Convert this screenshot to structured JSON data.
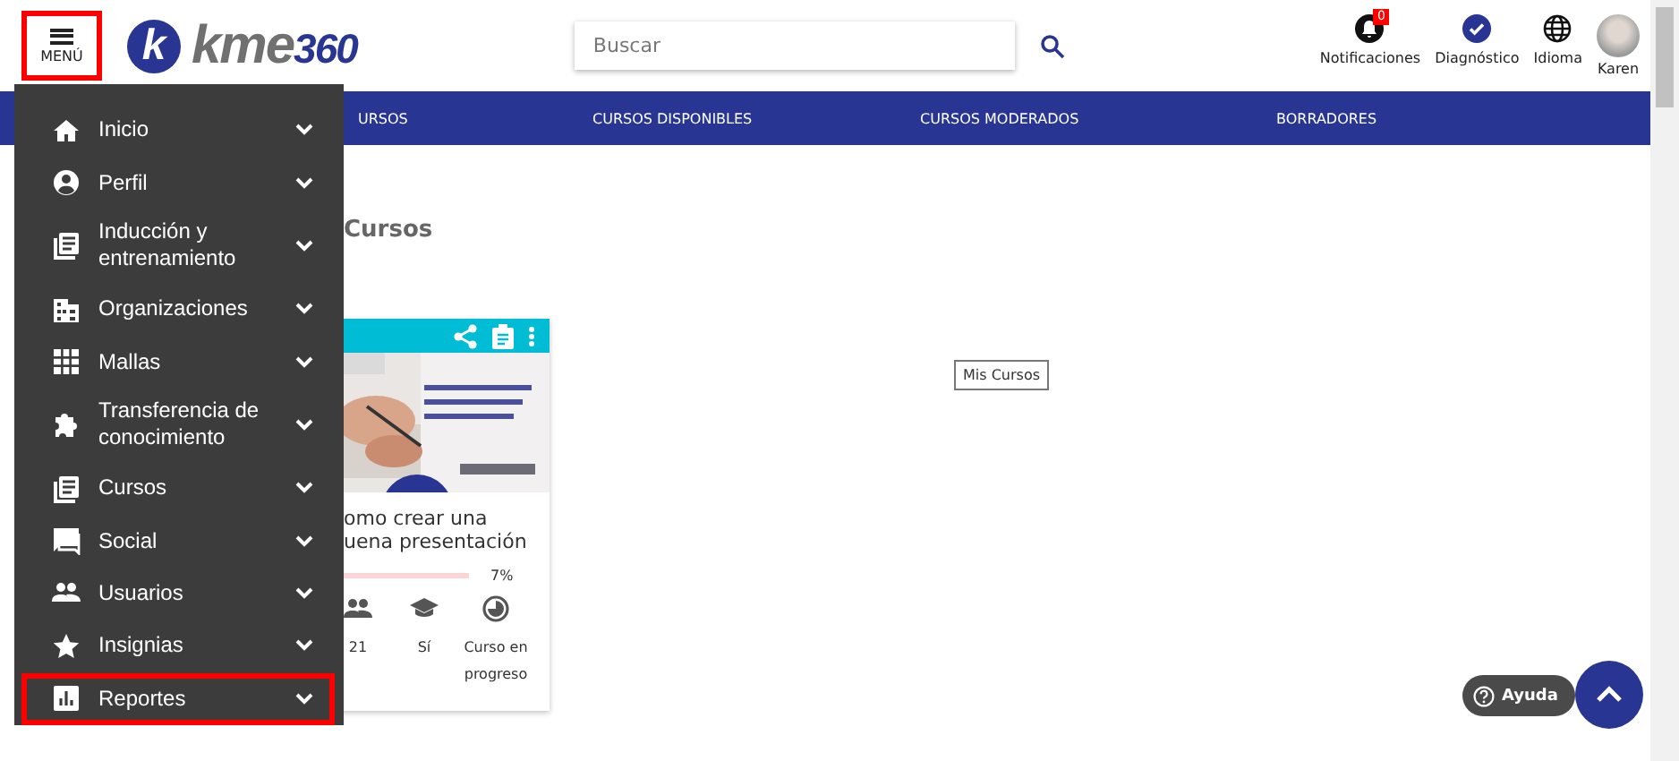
{
  "header": {
    "menu_button": {
      "label": "MENÚ",
      "highlighted": true
    },
    "logo": {
      "letter": "k",
      "name": "kme",
      "suffix": "360"
    },
    "search": {
      "placeholder": "Buscar"
    },
    "actions": [
      {
        "kind": "notifications",
        "label": "Notificaciones",
        "badge": "0"
      },
      {
        "kind": "diagnostic",
        "label": "Diagnóstico"
      },
      {
        "kind": "language",
        "label": "Idioma"
      },
      {
        "kind": "avatar",
        "label": "Karen"
      }
    ]
  },
  "nav_tabs": [
    {
      "label": "URSOS"
    },
    {
      "label": "CURSOS DISPONIBLES"
    },
    {
      "label": "CURSOS MODERADOS"
    },
    {
      "label": "BORRADORES"
    }
  ],
  "menu": {
    "items": [
      {
        "kind": "home",
        "label": "Inicio",
        "highlighted": false
      },
      {
        "kind": "person",
        "label": "Perfil",
        "highlighted": false
      },
      {
        "kind": "book",
        "label": "Inducción y entrenamiento",
        "highlighted": false
      },
      {
        "kind": "building",
        "label": "Organizaciones",
        "highlighted": false
      },
      {
        "kind": "grid",
        "label": "Mallas",
        "highlighted": false
      },
      {
        "kind": "puzzle",
        "label": "Transferencia de conocimiento",
        "highlighted": false
      },
      {
        "kind": "book",
        "label": "Cursos",
        "highlighted": false
      },
      {
        "kind": "chat",
        "label": "Social",
        "highlighted": false
      },
      {
        "kind": "people",
        "label": "Usuarios",
        "highlighted": false
      },
      {
        "kind": "star",
        "label": "Insignias",
        "highlighted": false
      },
      {
        "kind": "chart",
        "label": "Reportes",
        "highlighted": true
      }
    ]
  },
  "page_title": "Cursos",
  "tooltip": "Mis Cursos",
  "course_card": {
    "title": "omo crear una\nuena presentación",
    "progress": "7%",
    "stats": [
      {
        "kind": "people",
        "label": "21"
      },
      {
        "kind": "graduation",
        "label": "Sí"
      },
      {
        "kind": "progress",
        "label": "Curso en progreso"
      }
    ]
  },
  "help_button": "Ayuda"
}
